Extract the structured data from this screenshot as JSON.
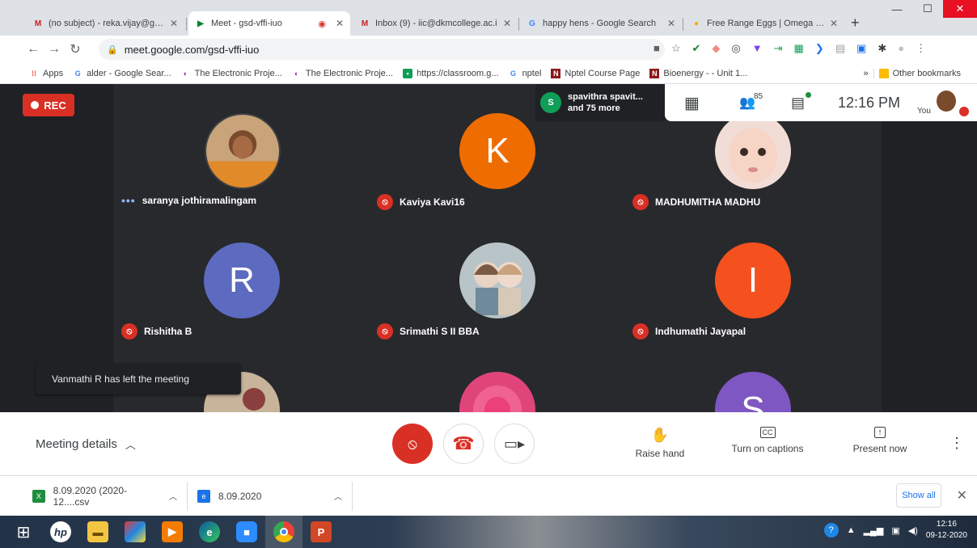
{
  "browser": {
    "tabs": [
      {
        "label": "(no subject) - reka.vijay@gmail",
        "favicon": "M",
        "color": "#c5221f"
      },
      {
        "label": "Meet - gsd-vffi-iuo",
        "favicon": "▶",
        "color": "#00832d",
        "active": true
      },
      {
        "label": "Inbox (9) - iic@dkmcollege.ac.i",
        "favicon": "M",
        "color": "#c5221f"
      },
      {
        "label": "happy hens - Google Search",
        "favicon": "G",
        "color": "#4285f4"
      },
      {
        "label": "Free Range Eggs | Omega 3 | C",
        "favicon": "●",
        "color": "#f9ab00"
      }
    ],
    "new_tab": "+",
    "url": "meet.google.com/gsd-vffi-iuo",
    "bookmarks": [
      {
        "label": "Apps",
        "icon": "apps-icon"
      },
      {
        "label": "alder - Google Sear...",
        "icon": "G"
      },
      {
        "label": "The Electronic Proje...",
        "icon": "E"
      },
      {
        "label": "The Electronic Proje...",
        "icon": "E"
      },
      {
        "label": "https://classroom.g...",
        "icon": "C"
      },
      {
        "label": "nptel",
        "icon": "G"
      },
      {
        "label": "Nptel Course Page",
        "icon": "N"
      },
      {
        "label": "Bioenergy - - Unit 1...",
        "icon": "N"
      }
    ],
    "other_bookmarks": "Other bookmarks",
    "more_bookmarks": "»"
  },
  "meet": {
    "rec_label": "REC",
    "chat_who": {
      "initial": "S",
      "line1": "spavithra spavit...",
      "line2": "and 75 more"
    },
    "participant_count": "85",
    "time": "12:16 PM",
    "self_label": "You",
    "participants": [
      {
        "name": "saranya jothiramalingam",
        "avatar": "photo",
        "muted": false,
        "color": "#c98a45"
      },
      {
        "name": "Kaviya Kavi16",
        "avatar": "K",
        "muted": true,
        "color": "#ef6c00"
      },
      {
        "name": "MADHUMITHA MADHU",
        "avatar": "photo",
        "muted": true,
        "color": "#e8c7bd"
      },
      {
        "name": "Rishitha B",
        "avatar": "R",
        "muted": true,
        "color": "#5c6bc0"
      },
      {
        "name": "Srimathi S II BBA",
        "avatar": "photo",
        "muted": true,
        "color": "#a7b3ba"
      },
      {
        "name": "Indhumathi Jayapal",
        "avatar": "I",
        "muted": true,
        "color": "#f4511e"
      },
      {
        "name": "",
        "avatar": "photo",
        "muted": false,
        "color": "#b9a58a"
      },
      {
        "name": "",
        "avatar": "photo",
        "muted": false,
        "color": "#e84a7a"
      },
      {
        "name": "",
        "avatar": "S",
        "muted": false,
        "color": "#7e57c2"
      }
    ],
    "notification": "Vanmathi R has left the meeting",
    "meeting_details": "Meeting details",
    "controls": {
      "raise_hand": "Raise hand",
      "captions": "Turn on captions",
      "present": "Present now",
      "captions_icon_text": "CC"
    }
  },
  "downloads": {
    "items": [
      {
        "name": "8.09.2020 (2020-12....csv"
      },
      {
        "name": "8.09.2020"
      }
    ],
    "show_all": "Show all"
  },
  "taskbar": {
    "clock_time": "12:16",
    "clock_date": "09-12-2020"
  }
}
